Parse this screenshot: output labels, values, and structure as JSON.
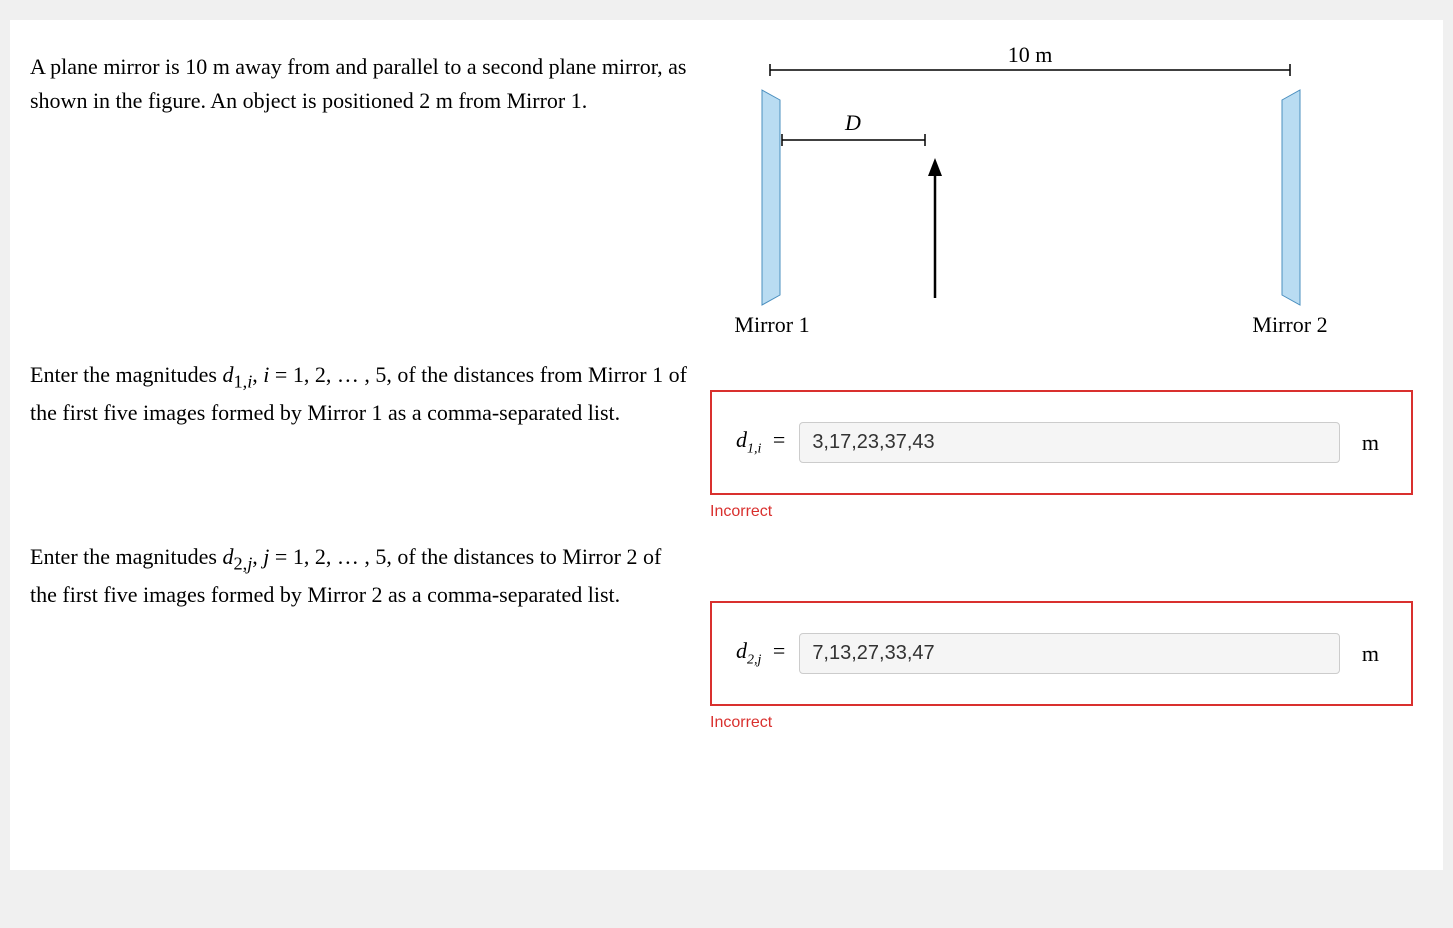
{
  "problem": {
    "statement": "A plane mirror is 10 m away from and parallel to a second plane mirror, as shown in the figure. An object is positioned 2 m from Mirror 1."
  },
  "figure": {
    "distance_label": "10 m",
    "object_distance_label": "D",
    "mirror1_label": "Mirror 1",
    "mirror2_label": "Mirror 2"
  },
  "questions": {
    "q1": {
      "prompt_pre": "Enter the magnitudes ",
      "prompt_var_html": "d<sub>1,i</sub>, i = 1, 2, … , 5,",
      "prompt_post": " of the distances from Mirror 1 of the first five images formed by Mirror 1 as a comma-separated list.",
      "label_base": "d",
      "label_sub": "1,i",
      "value": "3,17,23,37,43",
      "unit": "m",
      "feedback": "Incorrect"
    },
    "q2": {
      "prompt_pre": "Enter the magnitudes ",
      "prompt_var_html": "d<sub>2,j</sub>, j = 1, 2, … , 5,",
      "prompt_post": " of the distances to Mirror 2 of the first five images formed by Mirror 2 as a comma-separated list.",
      "label_base": "d",
      "label_sub": "2,j",
      "value": "7,13,27,33,47",
      "unit": "m",
      "feedback": "Incorrect"
    }
  }
}
